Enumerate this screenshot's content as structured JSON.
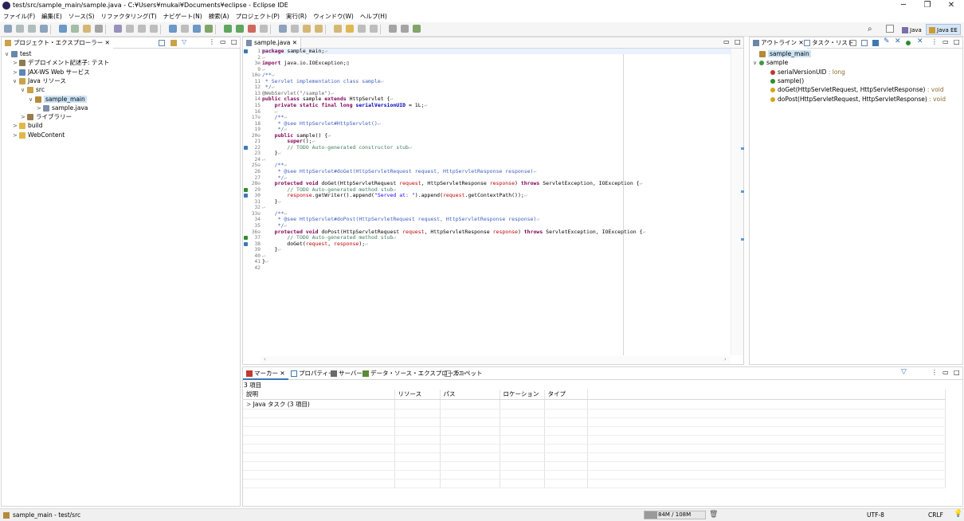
{
  "window": {
    "title": "test/src/sample_main/sample.java - C:¥Users¥mukai¥Documents¥eclipse - Eclipse IDE"
  },
  "menu": [
    "ファイル(F)",
    "編集(E)",
    "ソース(S)",
    "リファクタリング(T)",
    "ナビゲート(N)",
    "検索(A)",
    "プロジェクト(P)",
    "実行(R)",
    "ウィンドウ(W)",
    "ヘルプ(H)"
  ],
  "perspectives": {
    "java": "Java",
    "javaee": "Java EE"
  },
  "explorer": {
    "tab": "プロジェクト・エクスプローラー",
    "items": [
      {
        "label": "test",
        "depth": 0,
        "fold": "∨",
        "icon": "project-icon",
        "color": "#6a87a8"
      },
      {
        "label": "デプロイメント記述子: テスト",
        "depth": 1,
        "fold": ">",
        "icon": "descriptor-icon",
        "color": "#8c7a52"
      },
      {
        "label": "JAX-WS Web サービス",
        "depth": 1,
        "fold": ">",
        "icon": "webservice-icon",
        "color": "#5e86b5"
      },
      {
        "label": "Java リソース",
        "depth": 1,
        "fold": "∨",
        "icon": "java-resources-icon",
        "color": "#c9a24a"
      },
      {
        "label": "src",
        "depth": 2,
        "fold": "∨",
        "icon": "source-folder-icon",
        "color": "#c9a24a"
      },
      {
        "label": "sample_main",
        "depth": 3,
        "fold": "∨",
        "icon": "package-icon",
        "color": "#b58a3a",
        "selected": true
      },
      {
        "label": "sample.java",
        "depth": 4,
        "fold": ">",
        "icon": "java-file-icon",
        "color": "#7b8ea8"
      },
      {
        "label": "ライブラリー",
        "depth": 2,
        "fold": ">",
        "icon": "library-icon",
        "color": "#9a7b4a"
      },
      {
        "label": "build",
        "depth": 1,
        "fold": ">",
        "icon": "folder-icon",
        "color": "#e0b84a"
      },
      {
        "label": "WebContent",
        "depth": 1,
        "fold": ">",
        "icon": "folder-icon",
        "color": "#e0b84a"
      }
    ]
  },
  "editor": {
    "tab": "sample.java",
    "lines": [
      {
        "n": "1",
        "h": "<span class=\"kw\">package</span> sample_main;<span class=\"ws\">↵</span>"
      },
      {
        "n": "2",
        "h": "<span class=\"ws\">↵</span>"
      },
      {
        "n": "3⊕",
        "h": "<span class=\"kw\">import</span> java.io.IOException;▯"
      },
      {
        "n": "9",
        "h": "<span class=\"ws\">↵</span>"
      },
      {
        "n": "10⊖",
        "h": "<span class=\"jd\">/**</span><span class=\"ws\">↵</span>"
      },
      {
        "n": "11",
        "h": "<span class=\"jd\"> * Servlet implementation class sample</span><span class=\"ws\">↵</span>"
      },
      {
        "n": "12",
        "h": "<span class=\"jd\"> */</span><span class=\"ws\">↵</span>"
      },
      {
        "n": "13",
        "h": "<span class=\"an\">@WebServlet(\"/sample\")</span><span class=\"ws\">↵</span>"
      },
      {
        "n": "14",
        "h": "<span class=\"kw\">public class</span> sample <span class=\"kw\">extends</span> HttpServlet {<span class=\"ws\">↵</span>"
      },
      {
        "n": "15",
        "h": "    <span class=\"kw\">private static final long</span> <span class=\"fd\">serialVersionUID</span> = 1L;<span class=\"ws\">↵</span>"
      },
      {
        "n": "16",
        "h": "    <span class=\"ws\">↵</span>"
      },
      {
        "n": "17⊖",
        "h": "    <span class=\"jd\">/**</span><span class=\"ws\">↵</span>"
      },
      {
        "n": "18",
        "h": "<span class=\"jd\">     * @see HttpServlet#HttpServlet()</span><span class=\"ws\">↵</span>"
      },
      {
        "n": "19",
        "h": "<span class=\"jd\">     */</span><span class=\"ws\">↵</span>"
      },
      {
        "n": "20⊖",
        "h": "    <span class=\"kw\">public</span> sample() {<span class=\"ws\">↵</span>"
      },
      {
        "n": "21",
        "h": "        <span class=\"kw\">super</span>();<span class=\"ws\">↵</span>"
      },
      {
        "n": "22",
        "h": "        <span class=\"cm\">// TODO Auto-generated constructor stub</span><span class=\"ws\">↵</span>"
      },
      {
        "n": "23",
        "h": "    }<span class=\"ws\">↵</span>"
      },
      {
        "n": "24",
        "h": "<span class=\"ws\">↵</span>"
      },
      {
        "n": "25⊖",
        "h": "    <span class=\"jd\">/**</span><span class=\"ws\">↵</span>"
      },
      {
        "n": "26",
        "h": "<span class=\"jd\">     * @see HttpServlet#doGet(HttpServletRequest request, HttpServletResponse response)</span><span class=\"ws\">↵</span>"
      },
      {
        "n": "27",
        "h": "<span class=\"jd\">     */</span><span class=\"ws\">↵</span>"
      },
      {
        "n": "28⊖",
        "h": "    <span class=\"kw\">protected void</span> doGet(HttpServletRequest <span class=\"pa\">request</span>, HttpServletResponse <span class=\"pa\">response</span>) <span class=\"kw\">throws</span> ServletException, IOException {<span class=\"ws\">↵</span>"
      },
      {
        "n": "29",
        "h": "        <span class=\"cm\">// TODO Auto-generated method stub</span><span class=\"ws\">↵</span>"
      },
      {
        "n": "30",
        "h": "        <span class=\"pa\">response</span>.getWriter().append(<span class=\"st\">\"Served at: \"</span>).append(<span class=\"pa\">request</span>.getContextPath());<span class=\"ws\">↵</span>"
      },
      {
        "n": "31",
        "h": "    }<span class=\"ws\">↵</span>"
      },
      {
        "n": "32",
        "h": "<span class=\"ws\">↵</span>"
      },
      {
        "n": "33⊖",
        "h": "    <span class=\"jd\">/**</span><span class=\"ws\">↵</span>"
      },
      {
        "n": "34",
        "h": "<span class=\"jd\">     * @see HttpServlet#doPost(HttpServletRequest request, HttpServletResponse response)</span><span class=\"ws\">↵</span>"
      },
      {
        "n": "35",
        "h": "<span class=\"jd\">     */</span><span class=\"ws\">↵</span>"
      },
      {
        "n": "36⊖",
        "h": "    <span class=\"kw\">protected void</span> doPost(HttpServletRequest <span class=\"pa\">request</span>, HttpServletResponse <span class=\"pa\">response</span>) <span class=\"kw\">throws</span> ServletException, IOException {<span class=\"ws\">↵</span>"
      },
      {
        "n": "37",
        "h": "        <span class=\"cm\">// TODO Auto-generated method stub</span><span class=\"ws\">↵</span>"
      },
      {
        "n": "38",
        "h": "        doGet(<span class=\"pa\">request</span>, <span class=\"pa\">response</span>);<span class=\"ws\">↵</span>"
      },
      {
        "n": "39",
        "h": "    }<span class=\"ws\">↵</span>"
      },
      {
        "n": "40",
        "h": "<span class=\"ws\">↵</span>"
      },
      {
        "n": "41",
        "h": "}<span class=\"ws\">↵</span>"
      },
      {
        "n": "42",
        "h": ""
      }
    ]
  },
  "outline": {
    "tabs": [
      "アウトライン",
      "タスク・リスト"
    ],
    "items": [
      {
        "label": "sample_main",
        "depth": 0,
        "fold": "",
        "icon": "package-icon",
        "color": "#b58a3a",
        "selected": true
      },
      {
        "label": "sample",
        "depth": 0,
        "fold": "∨",
        "icon": "class-icon",
        "color": "#3c9b3c"
      },
      {
        "label": "serialVersionUID",
        "type": " : long",
        "depth": 1,
        "fold": "",
        "icon": "field-icon",
        "color": "#c0392b"
      },
      {
        "label": "sample()",
        "depth": 1,
        "fold": "",
        "icon": "constructor-icon",
        "color": "#2e8b2e"
      },
      {
        "label": "doGet(HttpServletRequest, HttpServletResponse)",
        "type": " : void",
        "depth": 1,
        "fold": "",
        "icon": "method-icon",
        "color": "#d7a31a"
      },
      {
        "label": "doPost(HttpServletRequest, HttpServletResponse)",
        "type": " : void",
        "depth": 1,
        "fold": "",
        "icon": "method-icon",
        "color": "#d7a31a"
      }
    ]
  },
  "bottom": {
    "tabs": [
      "マーカー",
      "プロパティー",
      "サーバー",
      "データ・ソース・エクスプローラー",
      "スニペット"
    ],
    "count": "3 項目",
    "columns": [
      "説明",
      "リソース",
      "パス",
      "ロケーション",
      "タイプ"
    ],
    "rows": [
      {
        "label": "Java タスク (3 項目)"
      }
    ]
  },
  "status": {
    "left": "sample_main - test/src",
    "heap": "84M / 108M",
    "encoding": "UTF-8",
    "eol": "CRLF"
  }
}
